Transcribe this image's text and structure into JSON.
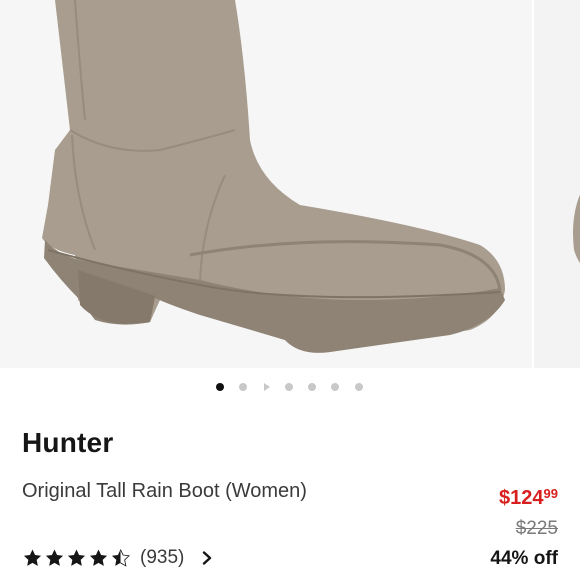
{
  "product": {
    "image_alt": "Taupe rain boot",
    "brand": "Hunter",
    "name": "Original Tall Rain Boot (Women)",
    "rating": 4.5,
    "max_rating": 5,
    "review_count": "(935)",
    "price_sale_dollars": "$124",
    "price_sale_cents": "99",
    "price_original": "$225",
    "discount": "44% off"
  },
  "carousel": {
    "total_slides": 7,
    "active_index": 0
  },
  "colors": {
    "boot": "#a89d8e",
    "boot_shadow": "#8e8374",
    "sale": "#d71f1f",
    "text_dark": "#161616",
    "text_body": "#3a3a3a"
  },
  "icons": {
    "star": "star-icon",
    "half_star": "half-star-icon",
    "chevron": "chevron-right-icon"
  }
}
